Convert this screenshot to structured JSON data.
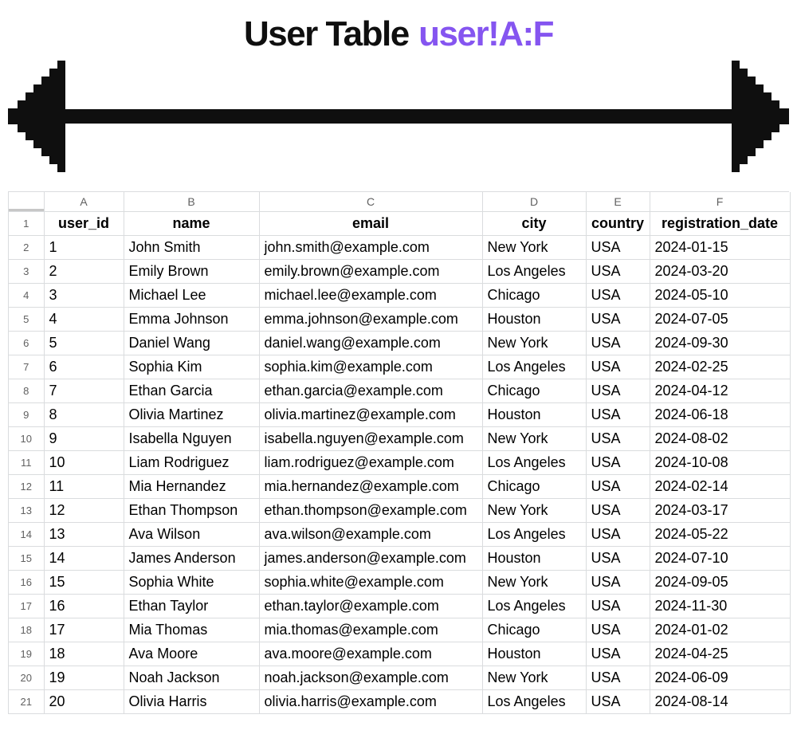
{
  "title": {
    "main": "User Table",
    "range": "user!A:F"
  },
  "arrow_icon": "double-arrow-pixel-icon",
  "sheet": {
    "column_letters": [
      "A",
      "B",
      "C",
      "D",
      "E",
      "F"
    ],
    "row_numbers_start": 1,
    "row_numbers_end": 21,
    "headers": {
      "A": "user_id",
      "B": "name",
      "C": "email",
      "D": "city",
      "E": "country",
      "F": "registration_date"
    },
    "rows": [
      {
        "user_id": "1",
        "name": "John Smith",
        "email": "john.smith@example.com",
        "city": "New York",
        "country": "USA",
        "registration_date": "2024-01-15"
      },
      {
        "user_id": "2",
        "name": "Emily Brown",
        "email": "emily.brown@example.com",
        "city": "Los Angeles",
        "country": "USA",
        "registration_date": "2024-03-20"
      },
      {
        "user_id": "3",
        "name": "Michael Lee",
        "email": "michael.lee@example.com",
        "city": "Chicago",
        "country": "USA",
        "registration_date": "2024-05-10"
      },
      {
        "user_id": "4",
        "name": "Emma Johnson",
        "email": "emma.johnson@example.com",
        "city": "Houston",
        "country": "USA",
        "registration_date": "2024-07-05"
      },
      {
        "user_id": "5",
        "name": "Daniel Wang",
        "email": "daniel.wang@example.com",
        "city": "New York",
        "country": "USA",
        "registration_date": "2024-09-30"
      },
      {
        "user_id": "6",
        "name": "Sophia Kim",
        "email": "sophia.kim@example.com",
        "city": "Los Angeles",
        "country": "USA",
        "registration_date": "2024-02-25"
      },
      {
        "user_id": "7",
        "name": "Ethan Garcia",
        "email": "ethan.garcia@example.com",
        "city": "Chicago",
        "country": "USA",
        "registration_date": "2024-04-12"
      },
      {
        "user_id": "8",
        "name": "Olivia Martinez",
        "email": "olivia.martinez@example.com",
        "city": "Houston",
        "country": "USA",
        "registration_date": "2024-06-18"
      },
      {
        "user_id": "9",
        "name": "Isabella Nguyen",
        "email": "isabella.nguyen@example.com",
        "city": "New York",
        "country": "USA",
        "registration_date": "2024-08-02"
      },
      {
        "user_id": "10",
        "name": "Liam Rodriguez",
        "email": "liam.rodriguez@example.com",
        "city": "Los Angeles",
        "country": "USA",
        "registration_date": "2024-10-08"
      },
      {
        "user_id": "11",
        "name": "Mia Hernandez",
        "email": "mia.hernandez@example.com",
        "city": "Chicago",
        "country": "USA",
        "registration_date": "2024-02-14"
      },
      {
        "user_id": "12",
        "name": "Ethan Thompson",
        "email": "ethan.thompson@example.com",
        "city": "New York",
        "country": "USA",
        "registration_date": "2024-03-17"
      },
      {
        "user_id": "13",
        "name": "Ava Wilson",
        "email": "ava.wilson@example.com",
        "city": "Los Angeles",
        "country": "USA",
        "registration_date": "2024-05-22"
      },
      {
        "user_id": "14",
        "name": "James Anderson",
        "email": "james.anderson@example.com",
        "city": "Houston",
        "country": "USA",
        "registration_date": "2024-07-10"
      },
      {
        "user_id": "15",
        "name": "Sophia White",
        "email": "sophia.white@example.com",
        "city": "New York",
        "country": "USA",
        "registration_date": "2024-09-05"
      },
      {
        "user_id": "16",
        "name": "Ethan Taylor",
        "email": "ethan.taylor@example.com",
        "city": "Los Angeles",
        "country": "USA",
        "registration_date": "2024-11-30"
      },
      {
        "user_id": "17",
        "name": "Mia Thomas",
        "email": "mia.thomas@example.com",
        "city": "Chicago",
        "country": "USA",
        "registration_date": "2024-01-02"
      },
      {
        "user_id": "18",
        "name": "Ava Moore",
        "email": "ava.moore@example.com",
        "city": "Houston",
        "country": "USA",
        "registration_date": "2024-04-25"
      },
      {
        "user_id": "19",
        "name": "Noah Jackson",
        "email": "noah.jackson@example.com",
        "city": "New York",
        "country": "USA",
        "registration_date": "2024-06-09"
      },
      {
        "user_id": "20",
        "name": "Olivia Harris",
        "email": "olivia.harris@example.com",
        "city": "Los Angeles",
        "country": "USA",
        "registration_date": "2024-08-14"
      }
    ]
  }
}
